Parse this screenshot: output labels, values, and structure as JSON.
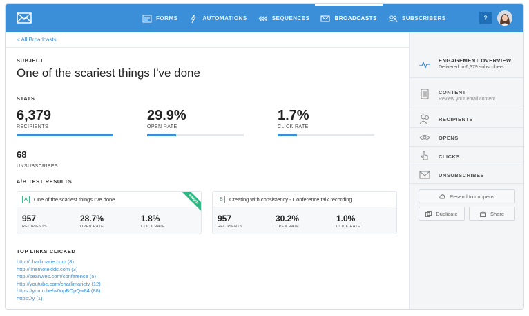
{
  "nav": {
    "items": [
      {
        "label": "FORMS",
        "icon": "forms-icon"
      },
      {
        "label": "AUTOMATIONS",
        "icon": "lightning-icon"
      },
      {
        "label": "SEQUENCES",
        "icon": "sequences-icon"
      },
      {
        "label": "BROADCASTS",
        "icon": "envelope-icon",
        "active": true
      },
      {
        "label": "SUBSCRIBERS",
        "icon": "subscribers-icon"
      }
    ],
    "help_label": "?"
  },
  "breadcrumb": "< All Broadcasts",
  "subject": {
    "label": "SUBJECT",
    "title": "One of the scariest things I've done"
  },
  "stats": {
    "label": "STATS",
    "recipients": {
      "value": "6,379",
      "caption": "RECIPIENTS",
      "bar_fill": 1.0
    },
    "open_rate": {
      "value": "29.9%",
      "caption": "OPEN RATE",
      "bar_fill": 0.299
    },
    "click_rate": {
      "value": "1.7%",
      "caption": "CLICK RATE",
      "bar_fill": 0.2
    },
    "unsubscribes": {
      "value": "68",
      "caption": "UNSUBSCRIBES"
    }
  },
  "ab": {
    "label": "A/B TEST RESULTS",
    "variants": [
      {
        "letter": "A",
        "title": "One of the scariest things I've done",
        "winner_label": "WINNER",
        "recipients": "957",
        "recipients_cap": "RECIPIENTS",
        "open_rate": "28.7%",
        "open_cap": "OPEN RATE",
        "click_rate": "1.8%",
        "click_cap": "CLICK RATE"
      },
      {
        "letter": "B",
        "title": "Creating with consistency - Conference talk recording",
        "recipients": "957",
        "recipients_cap": "RECIPIENTS",
        "open_rate": "30.2%",
        "open_cap": "OPEN RATE",
        "click_rate": "1.0%",
        "click_cap": "CLICK RATE"
      }
    ]
  },
  "links": {
    "label": "TOP LINKS CLICKED",
    "items": [
      "http://charlimarie.com (8)",
      "http://linernotekids.com (3)",
      "http://seanwes.com/conference (5)",
      "http://youtube.com/charlimarietv (12)",
      "https://youtu.be/w0opBOpQw84 (88)",
      "https://y (1)"
    ]
  },
  "sidebar": {
    "items": [
      {
        "title": "ENGAGEMENT OVERVIEW",
        "sub": "Delivered to 6,379 subscribers",
        "icon": "activity-icon"
      },
      {
        "title": "CONTENT",
        "sub": "Review your email content",
        "icon": "document-icon"
      },
      {
        "title": "RECIPIENTS",
        "icon": "users-icon"
      },
      {
        "title": "OPENS",
        "icon": "eye-icon"
      },
      {
        "title": "CLICKS",
        "icon": "pointer-icon"
      },
      {
        "title": "UNSUBSCRIBES",
        "icon": "mail-icon"
      }
    ],
    "resend_label": "Resend to unopens",
    "duplicate_label": "Duplicate",
    "share_label": "Share"
  },
  "colors": {
    "accent": "#3a8fd8",
    "winner": "#2db883"
  }
}
